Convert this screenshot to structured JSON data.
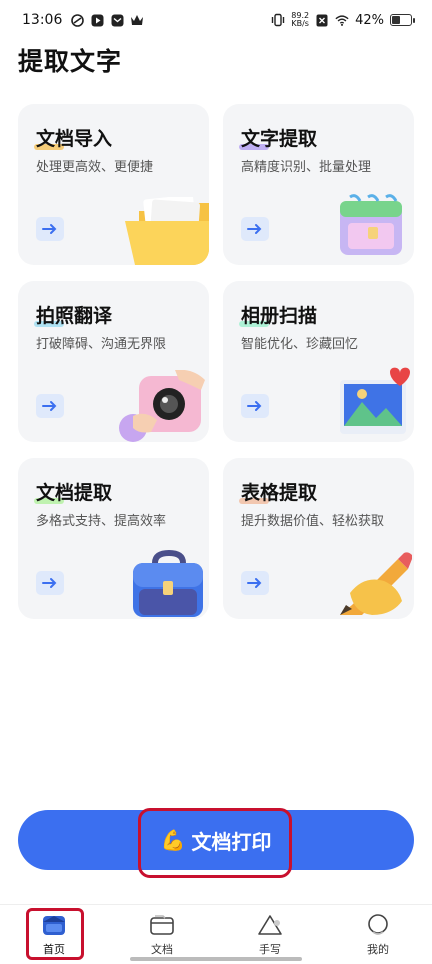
{
  "status_bar": {
    "time": "13:06",
    "net_speed_value": "89.2",
    "net_speed_unit": "KB/s",
    "battery": "42%",
    "battery_level": 0.42
  },
  "page": {
    "title": "提取文字"
  },
  "cards": [
    {
      "title": "文档导入",
      "subtitle": "处理更高效、更便捷",
      "accent": "#f5c86a",
      "icon": "folder-icon"
    },
    {
      "title": "文字提取",
      "subtitle": "高精度识别、批量处理",
      "accent": "#b9a7f2",
      "icon": "calendar-icon"
    },
    {
      "title": "拍照翻译",
      "subtitle": "打破障碍、沟通无界限",
      "accent": "#a7e0f2",
      "icon": "camera-icon"
    },
    {
      "title": "相册扫描",
      "subtitle": "智能优化、珍藏回忆",
      "accent": "#a7f2d3",
      "icon": "photo-album-icon"
    },
    {
      "title": "文档提取",
      "subtitle": "多格式支持、提高效率",
      "accent": "#b9f2a7",
      "icon": "briefcase-icon"
    },
    {
      "title": "表格提取",
      "subtitle": "提升数据价值、轻松获取",
      "accent": "#f2c2a7",
      "icon": "pencil-hand-icon"
    }
  ],
  "print_button": {
    "label": "文档打印",
    "icon": "💪"
  },
  "tabs": [
    {
      "label": "首页",
      "icon": "home-icon",
      "active": true
    },
    {
      "label": "文档",
      "icon": "folder-tab-icon"
    },
    {
      "label": "手写",
      "icon": "triangle-icon"
    },
    {
      "label": "我的",
      "icon": "profile-icon"
    }
  ],
  "colors": {
    "accent": "#3b6ff0",
    "highlight": "#c8102e",
    "card_bg": "#f4f5f7"
  }
}
